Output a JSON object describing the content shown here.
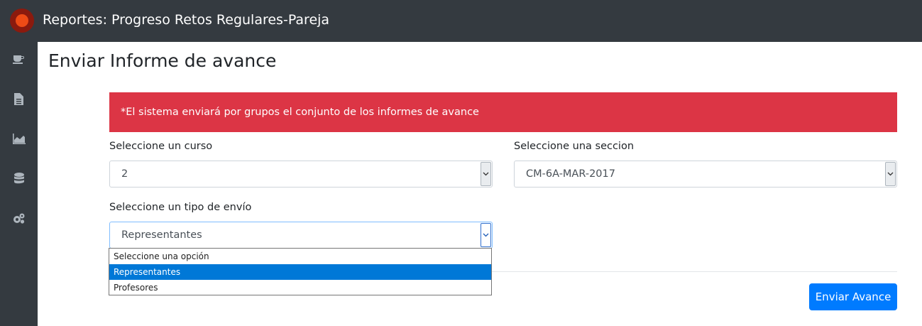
{
  "app": {
    "title": "Reportes: Progreso Retos Regulares-Pareja"
  },
  "sidebar": {
    "items": [
      {
        "icon": "coffee-icon"
      },
      {
        "icon": "document-icon"
      },
      {
        "icon": "area-chart-icon"
      },
      {
        "icon": "database-icon"
      },
      {
        "icon": "gears-icon"
      }
    ]
  },
  "page": {
    "title": "Enviar Informe de avance"
  },
  "alert": {
    "text": "*El sistema enviará por grupos el conjunto de los informes de avance",
    "color": "#dc3545"
  },
  "form": {
    "curso": {
      "label": "Seleccione un curso",
      "value": "2"
    },
    "seccion": {
      "label": "Seleccione una seccion",
      "value": "CM-6A-MAR-2017"
    },
    "tipo_envio": {
      "label": "Seleccione un tipo de envío",
      "value": "Representantes",
      "options": [
        "Seleccione una opción",
        "Representantes",
        "Profesores"
      ],
      "highlighted": "Representantes"
    }
  },
  "actions": {
    "submit_label": "Enviar Avance",
    "submit_color": "#007bff"
  }
}
